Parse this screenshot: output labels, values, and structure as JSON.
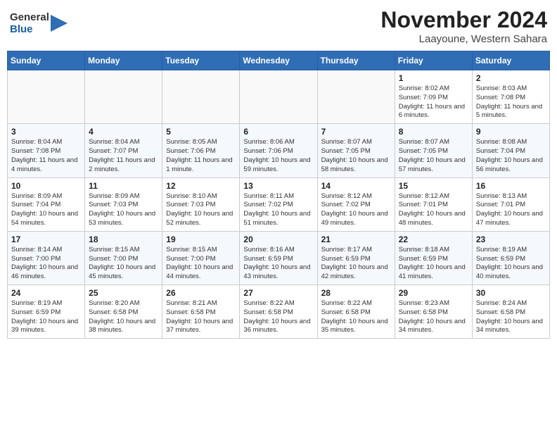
{
  "header": {
    "logo_general": "General",
    "logo_blue": "Blue",
    "title": "November 2024",
    "subtitle": "Laayoune, Western Sahara"
  },
  "days_of_week": [
    "Sunday",
    "Monday",
    "Tuesday",
    "Wednesday",
    "Thursday",
    "Friday",
    "Saturday"
  ],
  "weeks": [
    {
      "days": [
        {
          "num": "",
          "info": ""
        },
        {
          "num": "",
          "info": ""
        },
        {
          "num": "",
          "info": ""
        },
        {
          "num": "",
          "info": ""
        },
        {
          "num": "",
          "info": ""
        },
        {
          "num": "1",
          "info": "Sunrise: 8:02 AM\nSunset: 7:09 PM\nDaylight: 11 hours and 6 minutes."
        },
        {
          "num": "2",
          "info": "Sunrise: 8:03 AM\nSunset: 7:08 PM\nDaylight: 11 hours and 5 minutes."
        }
      ]
    },
    {
      "days": [
        {
          "num": "3",
          "info": "Sunrise: 8:04 AM\nSunset: 7:08 PM\nDaylight: 11 hours and 4 minutes."
        },
        {
          "num": "4",
          "info": "Sunrise: 8:04 AM\nSunset: 7:07 PM\nDaylight: 11 hours and 2 minutes."
        },
        {
          "num": "5",
          "info": "Sunrise: 8:05 AM\nSunset: 7:06 PM\nDaylight: 11 hours and 1 minute."
        },
        {
          "num": "6",
          "info": "Sunrise: 8:06 AM\nSunset: 7:06 PM\nDaylight: 10 hours and 59 minutes."
        },
        {
          "num": "7",
          "info": "Sunrise: 8:07 AM\nSunset: 7:05 PM\nDaylight: 10 hours and 58 minutes."
        },
        {
          "num": "8",
          "info": "Sunrise: 8:07 AM\nSunset: 7:05 PM\nDaylight: 10 hours and 57 minutes."
        },
        {
          "num": "9",
          "info": "Sunrise: 8:08 AM\nSunset: 7:04 PM\nDaylight: 10 hours and 56 minutes."
        }
      ]
    },
    {
      "days": [
        {
          "num": "10",
          "info": "Sunrise: 8:09 AM\nSunset: 7:04 PM\nDaylight: 10 hours and 54 minutes."
        },
        {
          "num": "11",
          "info": "Sunrise: 8:09 AM\nSunset: 7:03 PM\nDaylight: 10 hours and 53 minutes."
        },
        {
          "num": "12",
          "info": "Sunrise: 8:10 AM\nSunset: 7:03 PM\nDaylight: 10 hours and 52 minutes."
        },
        {
          "num": "13",
          "info": "Sunrise: 8:11 AM\nSunset: 7:02 PM\nDaylight: 10 hours and 51 minutes."
        },
        {
          "num": "14",
          "info": "Sunrise: 8:12 AM\nSunset: 7:02 PM\nDaylight: 10 hours and 49 minutes."
        },
        {
          "num": "15",
          "info": "Sunrise: 8:12 AM\nSunset: 7:01 PM\nDaylight: 10 hours and 48 minutes."
        },
        {
          "num": "16",
          "info": "Sunrise: 8:13 AM\nSunset: 7:01 PM\nDaylight: 10 hours and 47 minutes."
        }
      ]
    },
    {
      "days": [
        {
          "num": "17",
          "info": "Sunrise: 8:14 AM\nSunset: 7:00 PM\nDaylight: 10 hours and 46 minutes."
        },
        {
          "num": "18",
          "info": "Sunrise: 8:15 AM\nSunset: 7:00 PM\nDaylight: 10 hours and 45 minutes."
        },
        {
          "num": "19",
          "info": "Sunrise: 8:15 AM\nSunset: 7:00 PM\nDaylight: 10 hours and 44 minutes."
        },
        {
          "num": "20",
          "info": "Sunrise: 8:16 AM\nSunset: 6:59 PM\nDaylight: 10 hours and 43 minutes."
        },
        {
          "num": "21",
          "info": "Sunrise: 8:17 AM\nSunset: 6:59 PM\nDaylight: 10 hours and 42 minutes."
        },
        {
          "num": "22",
          "info": "Sunrise: 8:18 AM\nSunset: 6:59 PM\nDaylight: 10 hours and 41 minutes."
        },
        {
          "num": "23",
          "info": "Sunrise: 8:19 AM\nSunset: 6:59 PM\nDaylight: 10 hours and 40 minutes."
        }
      ]
    },
    {
      "days": [
        {
          "num": "24",
          "info": "Sunrise: 8:19 AM\nSunset: 6:59 PM\nDaylight: 10 hours and 39 minutes."
        },
        {
          "num": "25",
          "info": "Sunrise: 8:20 AM\nSunset: 6:58 PM\nDaylight: 10 hours and 38 minutes."
        },
        {
          "num": "26",
          "info": "Sunrise: 8:21 AM\nSunset: 6:58 PM\nDaylight: 10 hours and 37 minutes."
        },
        {
          "num": "27",
          "info": "Sunrise: 8:22 AM\nSunset: 6:58 PM\nDaylight: 10 hours and 36 minutes."
        },
        {
          "num": "28",
          "info": "Sunrise: 8:22 AM\nSunset: 6:58 PM\nDaylight: 10 hours and 35 minutes."
        },
        {
          "num": "29",
          "info": "Sunrise: 8:23 AM\nSunset: 6:58 PM\nDaylight: 10 hours and 34 minutes."
        },
        {
          "num": "30",
          "info": "Sunrise: 8:24 AM\nSunset: 6:58 PM\nDaylight: 10 hours and 34 minutes."
        }
      ]
    }
  ]
}
